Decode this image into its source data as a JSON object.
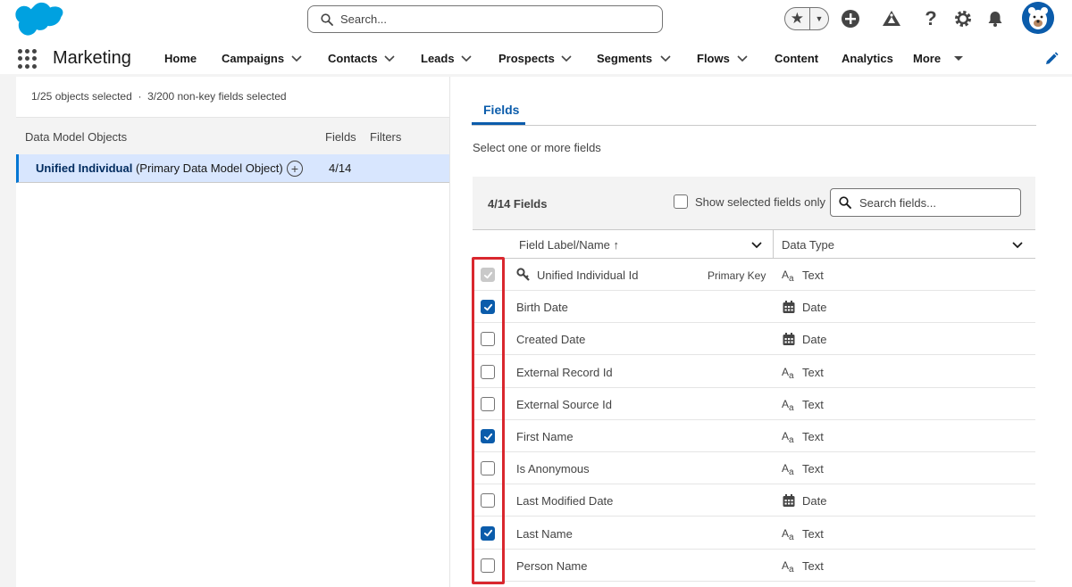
{
  "global_header": {
    "search_placeholder": "Search...",
    "icons": [
      "salesforce-cloud-logo",
      "star-icon",
      "chevron-down-icon",
      "add-icon",
      "trailhead-icon",
      "help-icon",
      "gear-icon",
      "bell-icon",
      "user-avatar"
    ]
  },
  "context_nav": {
    "app_name": "Marketing",
    "items": [
      {
        "label": "Home",
        "has_menu": false
      },
      {
        "label": "Campaigns",
        "has_menu": true
      },
      {
        "label": "Contacts",
        "has_menu": true
      },
      {
        "label": "Leads",
        "has_menu": true
      },
      {
        "label": "Prospects",
        "has_menu": true
      },
      {
        "label": "Segments",
        "has_menu": true
      },
      {
        "label": "Flows",
        "has_menu": true
      },
      {
        "label": "Content",
        "has_menu": false
      },
      {
        "label": "Analytics",
        "has_menu": false
      },
      {
        "label": "More",
        "has_menu": true
      }
    ]
  },
  "left_panel": {
    "objects_selected": "1/25",
    "objects_selected_suffix": "objects selected",
    "separator": "·",
    "fields_selected": "3/200",
    "fields_selected_suffix": "non-key fields selected",
    "columns": {
      "name": "Data Model Objects",
      "fields": "Fields",
      "filters": "Filters"
    },
    "object_row": {
      "name": "Unified Individual",
      "qualifier": "(Primary Data Model Object)",
      "fields_count": "4/14"
    }
  },
  "right_panel": {
    "tab_label": "Fields",
    "hint": "Select one or more fields",
    "fields_count": "4/14 Fields",
    "show_selected_label": "Show selected fields only",
    "search_placeholder": "Search fields...",
    "columns": {
      "label": "Field Label/Name",
      "sort_indicator": "↑",
      "type": "Data Type"
    },
    "rows": [
      {
        "label": "Unified Individual Id",
        "badge": "Primary Key",
        "type": "Text",
        "type_icon": "text-type-icon",
        "checked": true,
        "disabled": true,
        "key": true
      },
      {
        "label": "Birth Date",
        "type": "Date",
        "type_icon": "calendar-icon",
        "checked": true,
        "disabled": false
      },
      {
        "label": "Created Date",
        "type": "Date",
        "type_icon": "calendar-icon",
        "checked": false,
        "disabled": false
      },
      {
        "label": "External Record Id",
        "type": "Text",
        "type_icon": "text-type-icon",
        "checked": false,
        "disabled": false
      },
      {
        "label": "External Source Id",
        "type": "Text",
        "type_icon": "text-type-icon",
        "checked": false,
        "disabled": false
      },
      {
        "label": "First Name",
        "type": "Text",
        "type_icon": "text-type-icon",
        "checked": true,
        "disabled": false
      },
      {
        "label": "Is Anonymous",
        "type": "Text",
        "type_icon": "text-type-icon",
        "checked": false,
        "disabled": false
      },
      {
        "label": "Last Modified Date",
        "type": "Date",
        "type_icon": "calendar-icon",
        "checked": false,
        "disabled": false
      },
      {
        "label": "Last Name",
        "type": "Text",
        "type_icon": "text-type-icon",
        "checked": true,
        "disabled": false
      },
      {
        "label": "Person Name",
        "type": "Text",
        "type_icon": "text-type-icon",
        "checked": false,
        "disabled": false
      }
    ]
  },
  "colors": {
    "brand_blue": "#0b5cab",
    "logo_blue": "#00a1e0",
    "highlight_red": "#d9272e",
    "selected_row": "#d8e6fe"
  }
}
